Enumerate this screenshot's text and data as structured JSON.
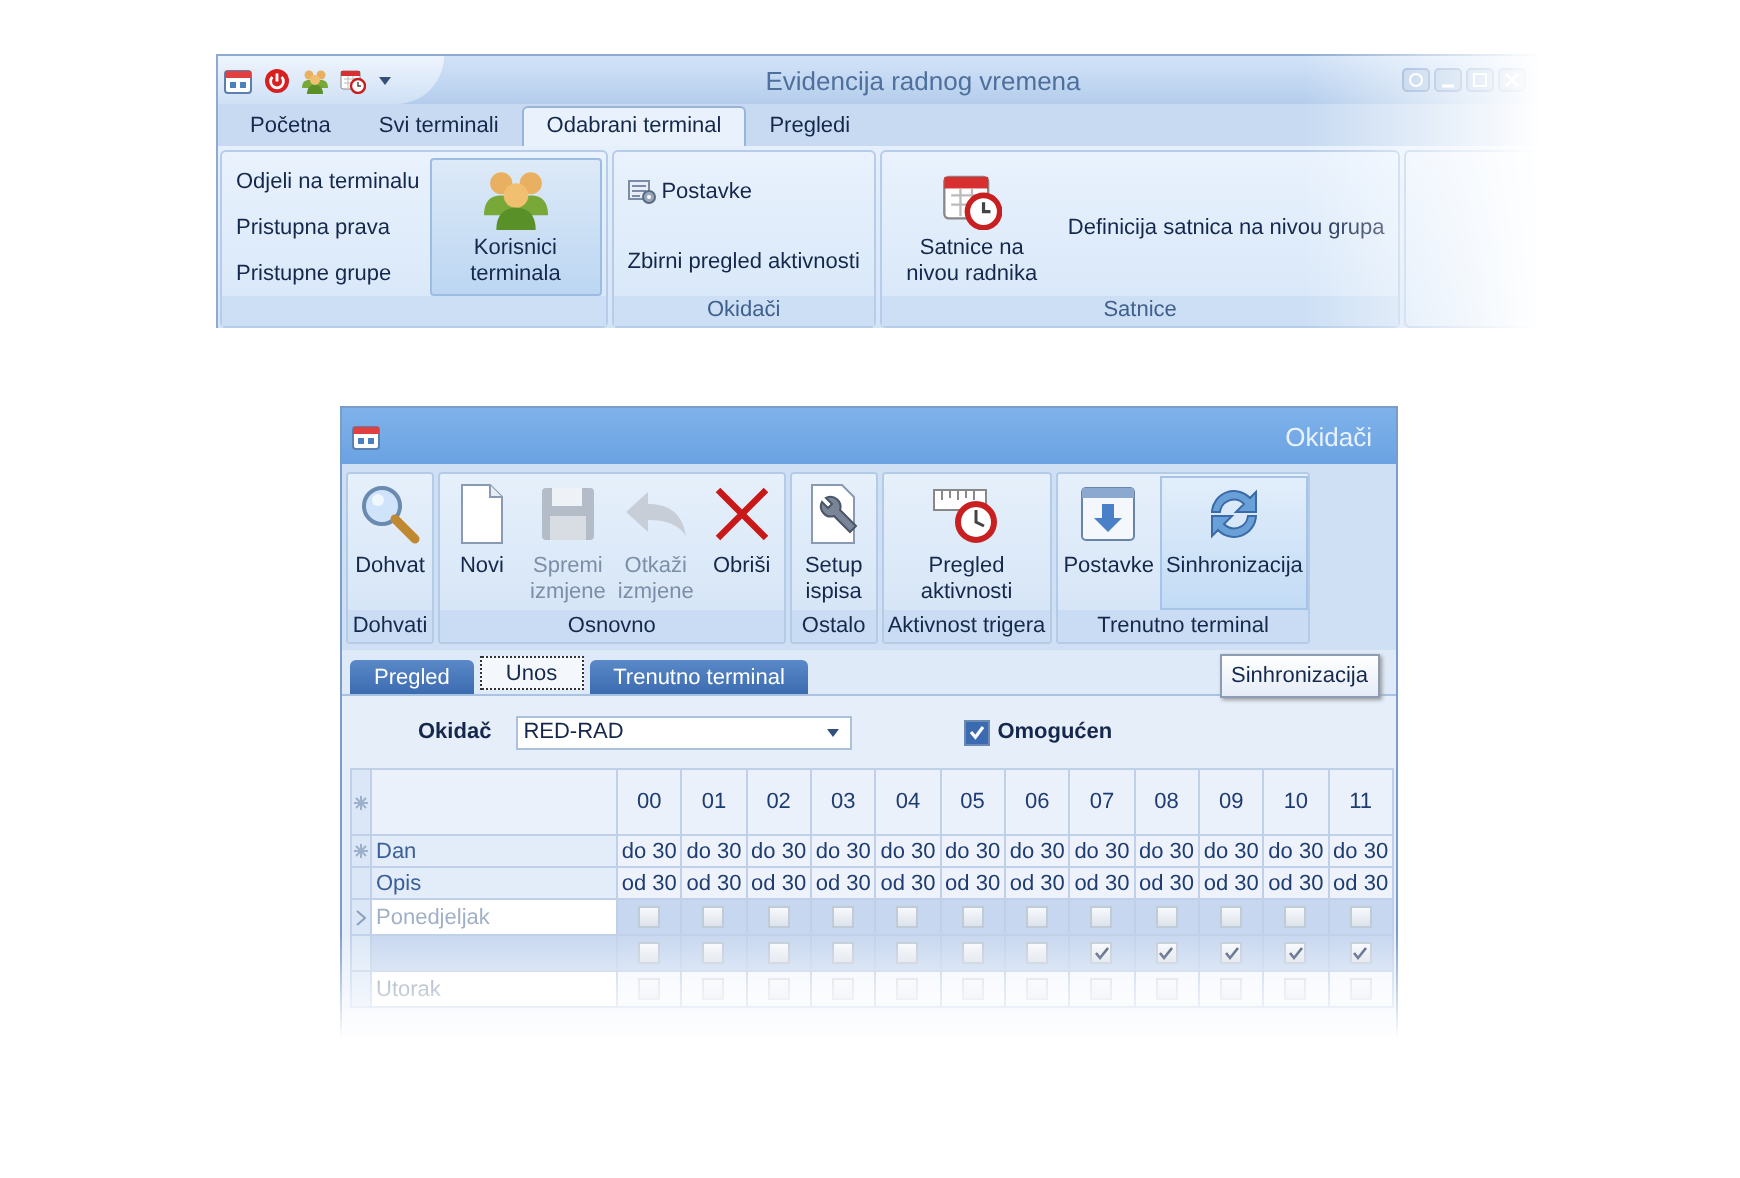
{
  "main_window": {
    "title": "Evidencija radnog vremena",
    "tabs": [
      {
        "label": "Početna",
        "selected": false
      },
      {
        "label": "Svi terminali",
        "selected": false
      },
      {
        "label": "Odabrani terminal",
        "selected": true
      },
      {
        "label": "Pregledi",
        "selected": false
      }
    ],
    "groups": [
      {
        "items": [
          {
            "kind": "small",
            "label": "Odjeli na terminalu"
          },
          {
            "kind": "small",
            "label": "Pristupna prava"
          },
          {
            "kind": "small",
            "label": "Pristupne grupe"
          },
          {
            "kind": "large",
            "label": "Korisnici terminala",
            "highlighted": true
          }
        ]
      },
      {
        "label": "Okidači",
        "items": [
          {
            "kind": "small",
            "label": "Postavke"
          },
          {
            "kind": "small",
            "label": "Zbirni pregled aktivnosti"
          }
        ]
      },
      {
        "label": "Satnice",
        "items": [
          {
            "kind": "large",
            "label": "Satnice na nivou radnika"
          },
          {
            "kind": "small",
            "label": "Definicija satnica na nivou grupa"
          }
        ]
      }
    ]
  },
  "form_window": {
    "title": "Okidači",
    "groups": [
      {
        "label": "Dohvati",
        "items": [
          {
            "label": "Dohvat",
            "disabled": false
          }
        ]
      },
      {
        "label": "Osnovno",
        "items": [
          {
            "label": "Novi",
            "disabled": false
          },
          {
            "label": "Spremi izmjene",
            "disabled": true
          },
          {
            "label": "Otkaži izmjene",
            "disabled": true
          },
          {
            "label": "Obriši",
            "disabled": false
          }
        ]
      },
      {
        "label": "Ostalo",
        "items": [
          {
            "label": "Setup ispisa",
            "disabled": false
          }
        ]
      },
      {
        "label": "Aktivnost trigera",
        "items": [
          {
            "label": "Pregled aktivnosti",
            "disabled": false
          }
        ]
      },
      {
        "label": "Trenutno terminal",
        "items": [
          {
            "label": "Postavke",
            "disabled": false
          },
          {
            "label": "Sinhronizacija",
            "disabled": false,
            "highlighted": true
          }
        ]
      }
    ],
    "tooltip": "Sinhronizacija",
    "tabs": [
      {
        "label": "Pregled",
        "selected": false
      },
      {
        "label": "Unos",
        "selected": true
      },
      {
        "label": "Trenutno terminal",
        "selected": false
      }
    ],
    "trigger_label": "Okidač",
    "trigger_value": "RED-RAD",
    "enabled": {
      "label": "Omogućen",
      "checked": true
    },
    "grid": {
      "columns": [
        "00",
        "01",
        "02",
        "03",
        "04",
        "05",
        "06",
        "07",
        "08",
        "09",
        "10",
        "11"
      ],
      "rows": [
        {
          "kind": "text",
          "label": "Dan",
          "cells": [
            "do 30",
            "do 30",
            "do 30",
            "do 30",
            "do 30",
            "do 30",
            "do 30",
            "do 30",
            "do 30",
            "do 30",
            "do 30",
            "do 30"
          ]
        },
        {
          "kind": "text",
          "label": "Opis",
          "cells": [
            "od 30",
            "od 30",
            "od 30",
            "od 30",
            "od 30",
            "od 30",
            "od 30",
            "od 30",
            "od 30",
            "od 30",
            "od 30",
            "od 30"
          ]
        },
        {
          "kind": "check",
          "label": "Ponedjeljak",
          "selected": true,
          "current": true,
          "checks": [
            false,
            false,
            false,
            false,
            false,
            false,
            false,
            false,
            false,
            false,
            false,
            false
          ]
        },
        {
          "kind": "check",
          "selected": true,
          "checks": [
            false,
            false,
            false,
            false,
            false,
            false,
            false,
            true,
            true,
            true,
            true,
            true
          ]
        },
        {
          "kind": "check",
          "label": "Utorak",
          "selected": false,
          "checks": [
            false,
            false,
            false,
            false,
            false,
            false,
            false,
            false,
            false,
            false,
            false,
            false
          ]
        }
      ]
    }
  }
}
